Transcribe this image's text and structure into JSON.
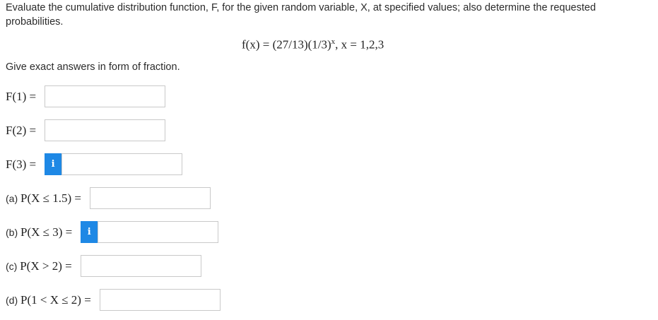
{
  "question": {
    "intro": "Evaluate the cumulative distribution function, F, for the given random variable, X, at specified values; also determine the requested probabilities.",
    "formula_main": "f(x) = (27/13)(1/3)",
    "formula_exp": "x",
    "formula_tail": ", x = 1,2,3",
    "hint": "Give exact answers in form of fraction."
  },
  "fields": [
    {
      "prefix": "",
      "math": "F(1) = ",
      "value": "",
      "has_info": false
    },
    {
      "prefix": "",
      "math": "F(2) = ",
      "value": "",
      "has_info": false
    },
    {
      "prefix": "",
      "math": "F(3) = ",
      "value": "",
      "has_info": true
    },
    {
      "prefix": "(a) ",
      "math": "P(X ≤ 1.5) = ",
      "value": "",
      "has_info": false
    },
    {
      "prefix": "(b) ",
      "math": "P(X ≤ 3) = ",
      "value": "",
      "has_info": true
    },
    {
      "prefix": "(c) ",
      "math": "P(X > 2) = ",
      "value": "",
      "has_info": false
    },
    {
      "prefix": "(d) ",
      "math": "P(1 < X ≤ 2) = ",
      "value": "",
      "has_info": false
    }
  ],
  "info_icon": {
    "glyph": "i",
    "name": "info-icon",
    "color": "#1e88e5"
  }
}
